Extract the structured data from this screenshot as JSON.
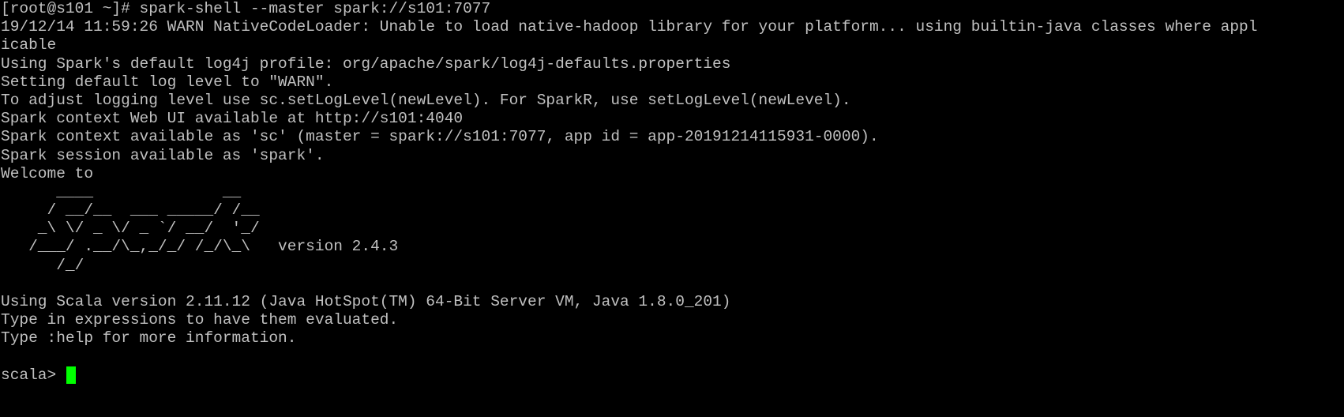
{
  "terminal": {
    "lines": [
      "[root@s101 ~]# spark-shell --master spark://s101:7077",
      "19/12/14 11:59:26 WARN NativeCodeLoader: Unable to load native-hadoop library for your platform... using builtin-java classes where appl",
      "icable",
      "Using Spark's default log4j profile: org/apache/spark/log4j-defaults.properties",
      "Setting default log level to \"WARN\".",
      "To adjust logging level use sc.setLogLevel(newLevel). For SparkR, use setLogLevel(newLevel).",
      "Spark context Web UI available at http://s101:4040",
      "Spark context available as 'sc' (master = spark://s101:7077, app id = app-20191214115931-0000).",
      "Spark session available as 'spark'.",
      "Welcome to"
    ],
    "banner": [
      "      ____              __",
      "     / __/__  ___ _____/ /__",
      "    _\\ \\/ _ \\/ _ `/ __/  '_/",
      "   /___/ .__/\\_,_/_/ /_/\\_\\   version 2.4.3",
      "      /_/"
    ],
    "after_banner": [
      "",
      "Using Scala version 2.11.12 (Java HotSpot(TM) 64-Bit Server VM, Java 1.8.0_201)",
      "Type in expressions to have them evaluated.",
      "Type :help for more information.",
      ""
    ],
    "prompt": "scala> ",
    "colors": {
      "background": "#000000",
      "text": "#c0c0c0",
      "cursor": "#00ff00"
    }
  }
}
